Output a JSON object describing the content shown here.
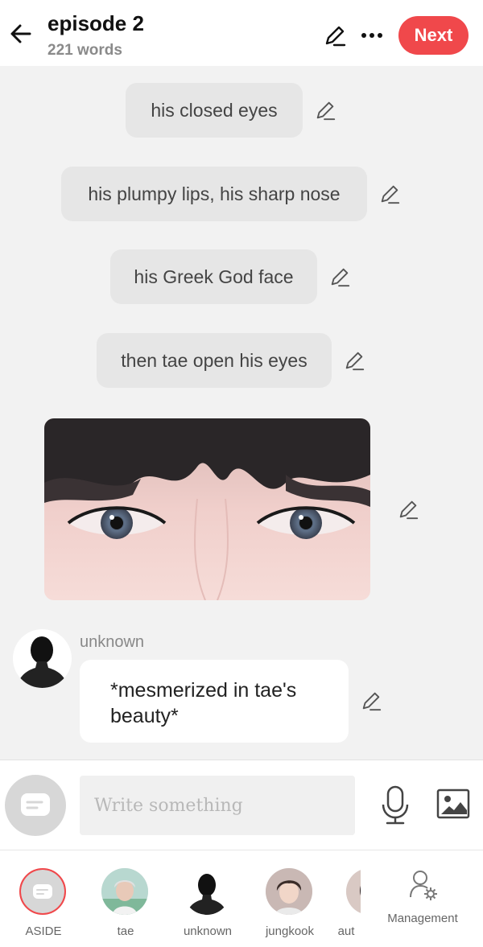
{
  "header": {
    "title": "episode 2",
    "word_count": "221 words",
    "next_label": "Next",
    "accent_color": "#f0484b"
  },
  "content": {
    "asides": [
      "his closed eyes",
      "his plumpy lips, his sharp nose",
      "his Greek God face",
      "then tae open his eyes"
    ],
    "message": {
      "speaker": "unknown",
      "text": "*mesmerized in tae's beauty*"
    }
  },
  "composer": {
    "placeholder": "Write something"
  },
  "characters": [
    {
      "name": "ASIDE"
    },
    {
      "name": "tae"
    },
    {
      "name": "unknown"
    },
    {
      "name": "jungkook"
    },
    {
      "name": "aut"
    }
  ],
  "management_label": "Management",
  "icons": {
    "back": "arrow-left-icon",
    "edit": "pencil-icon",
    "more": "more-horizontal-icon",
    "mic": "microphone-icon",
    "image": "image-icon",
    "aside": "chat-bubble-icon",
    "management": "user-settings-icon"
  }
}
